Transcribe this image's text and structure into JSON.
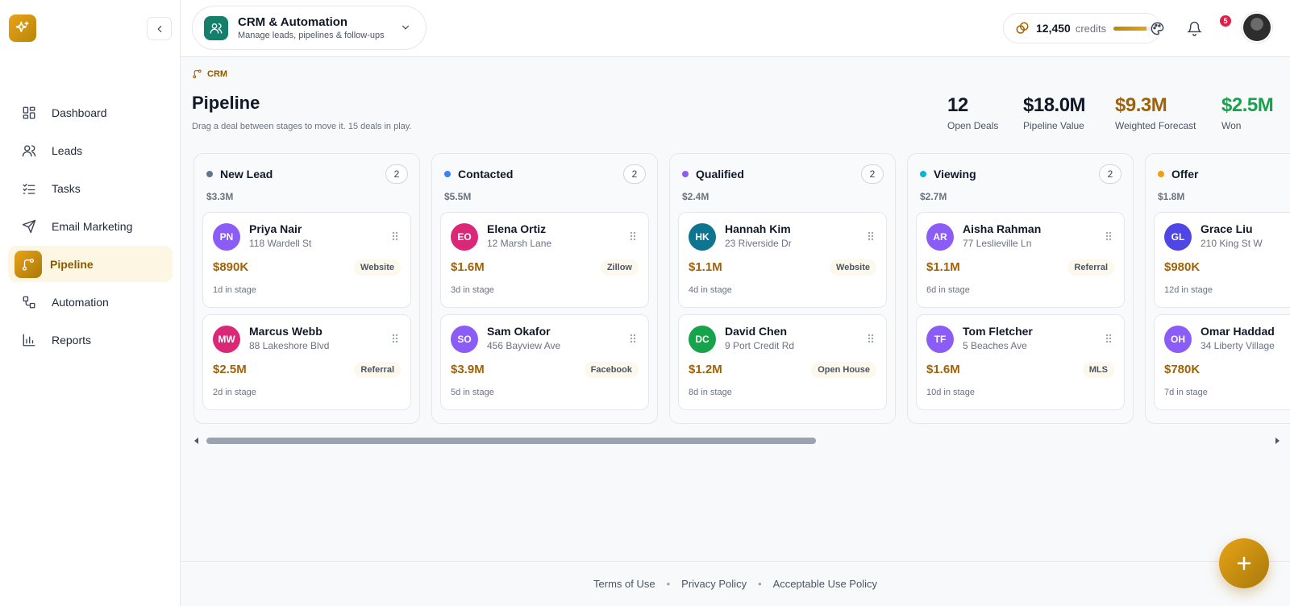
{
  "sidebar": {
    "items": [
      {
        "label": "Dashboard",
        "icon": "dashboard-icon"
      },
      {
        "label": "Leads",
        "icon": "users-icon"
      },
      {
        "label": "Tasks",
        "icon": "checklist-icon"
      },
      {
        "label": "Email Marketing",
        "icon": "send-icon"
      },
      {
        "label": "Pipeline",
        "icon": "pipeline-icon",
        "active": true
      },
      {
        "label": "Automation",
        "icon": "automation-icon"
      },
      {
        "label": "Reports",
        "icon": "bar-chart-icon"
      }
    ]
  },
  "workspace": {
    "title": "CRM & Automation",
    "subtitle": "Manage leads, pipelines & follow-ups"
  },
  "credits": {
    "value": "12,450",
    "label": "credits",
    "level": 0.85
  },
  "notifications": {
    "count": "5"
  },
  "breadcrumb": "CRM",
  "page": {
    "title": "Pipeline",
    "subtitle": "Drag a deal between stages to move it. 15 deals in play."
  },
  "stats": [
    {
      "value": "12",
      "label": "Open Deals",
      "color": "#111827"
    },
    {
      "value": "$18.0M",
      "label": "Pipeline Value",
      "color": "#111827"
    },
    {
      "value": "$9.3M",
      "label": "Weighted Forecast",
      "color": "#a16207"
    },
    {
      "value": "$2.5M",
      "label": "Won",
      "color": "#16a34a"
    }
  ],
  "columns": [
    {
      "name": "New Lead",
      "count": "2",
      "total": "$3.3M",
      "color": "#64748b",
      "cards": [
        {
          "initials": "PN",
          "name": "Priya Nair",
          "address": "118 Wardell St",
          "amount": "$890K",
          "source": "Website",
          "days": "1d in stage",
          "avatar_color": "#8b5cf6"
        },
        {
          "initials": "MW",
          "name": "Marcus Webb",
          "address": "88 Lakeshore Blvd",
          "amount": "$2.5M",
          "source": "Referral",
          "days": "2d in stage",
          "avatar_color": "#db2777"
        }
      ]
    },
    {
      "name": "Contacted",
      "count": "2",
      "total": "$5.5M",
      "color": "#3b82f6",
      "cards": [
        {
          "initials": "EO",
          "name": "Elena Ortiz",
          "address": "12 Marsh Lane",
          "amount": "$1.6M",
          "source": "Zillow",
          "days": "3d in stage",
          "avatar_color": "#db2777"
        },
        {
          "initials": "SO",
          "name": "Sam Okafor",
          "address": "456 Bayview Ave",
          "amount": "$3.9M",
          "source": "Facebook",
          "days": "5d in stage",
          "avatar_color": "#8b5cf6"
        }
      ]
    },
    {
      "name": "Qualified",
      "count": "2",
      "total": "$2.4M",
      "color": "#8b5cf6",
      "cards": [
        {
          "initials": "HK",
          "name": "Hannah Kim",
          "address": "23 Riverside Dr",
          "amount": "$1.1M",
          "source": "Website",
          "days": "4d in stage",
          "avatar_color": "#0e7490"
        },
        {
          "initials": "DC",
          "name": "David Chen",
          "address": "9 Port Credit Rd",
          "amount": "$1.2M",
          "source": "Open House",
          "days": "8d in stage",
          "avatar_color": "#16a34a"
        }
      ]
    },
    {
      "name": "Viewing",
      "count": "2",
      "total": "$2.7M",
      "color": "#06b6d4",
      "cards": [
        {
          "initials": "AR",
          "name": "Aisha Rahman",
          "address": "77 Leslieville Ln",
          "amount": "$1.1M",
          "source": "Referral",
          "days": "6d in stage",
          "avatar_color": "#8b5cf6"
        },
        {
          "initials": "TF",
          "name": "Tom Fletcher",
          "address": "5 Beaches Ave",
          "amount": "$1.6M",
          "source": "MLS",
          "days": "10d in stage",
          "avatar_color": "#8b5cf6"
        }
      ]
    },
    {
      "name": "Offer",
      "count": "",
      "total": "$1.8M",
      "color": "#f59e0b",
      "cards": [
        {
          "initials": "GL",
          "name": "Grace Liu",
          "address": "210 King St W",
          "amount": "$980K",
          "source": "",
          "days": "12d in stage",
          "avatar_color": "#4f46e5"
        },
        {
          "initials": "OH",
          "name": "Omar Haddad",
          "address": "34 Liberty Village",
          "amount": "$780K",
          "source": "",
          "days": "7d in stage",
          "avatar_color": "#8b5cf6"
        }
      ]
    }
  ],
  "footer": {
    "links": [
      "Terms of Use",
      "Privacy Policy",
      "Acceptable Use Policy"
    ]
  }
}
